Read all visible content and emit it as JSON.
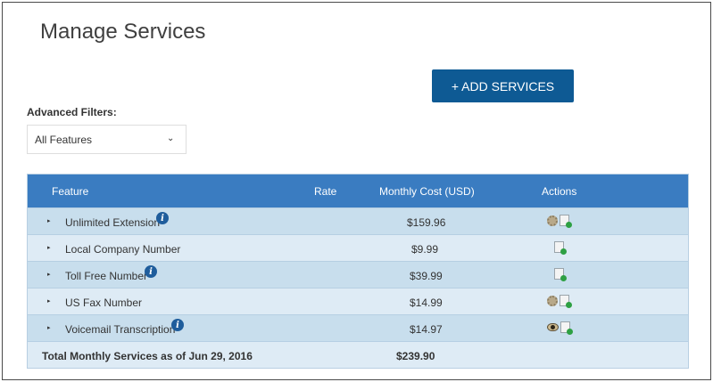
{
  "page": {
    "title": "Manage Services",
    "add_button": "+ ADD SERVICES",
    "filters_label": "Advanced Filters:",
    "filter_value": "All Features",
    "filter_chevron": "⌄"
  },
  "table": {
    "headers": {
      "feature": "Feature",
      "rate": "Rate",
      "monthly_cost": "Monthly Cost (USD)",
      "actions": "Actions"
    },
    "rows": [
      {
        "feature": "Unlimited Extension",
        "cost": "$159.96",
        "info": "i",
        "actions": [
          "gear-icon",
          "add-document-icon"
        ]
      },
      {
        "feature": "Local Company Number",
        "cost": "$9.99",
        "actions": [
          "add-document-icon"
        ]
      },
      {
        "feature": "Toll Free Number",
        "cost": "$39.99",
        "info": "i",
        "actions": [
          "add-document-icon"
        ]
      },
      {
        "feature": "US Fax Number",
        "cost": "$14.99",
        "actions": [
          "gear-icon",
          "add-document-icon"
        ]
      },
      {
        "feature": "Voicemail Transcription",
        "cost": "$14.97",
        "info": "i",
        "actions": [
          "eye-icon",
          "add-document-icon"
        ]
      }
    ],
    "total_label": "Total Monthly Services as of Jun 29, 2016",
    "total_value": "$239.90",
    "expand_glyph": "▸"
  },
  "colors": {
    "button": "#0e5a94",
    "header": "#3a7cc1",
    "row_dark": "#c8deed",
    "row_light": "#deebf5",
    "info_badge": "#1f5d9c"
  }
}
